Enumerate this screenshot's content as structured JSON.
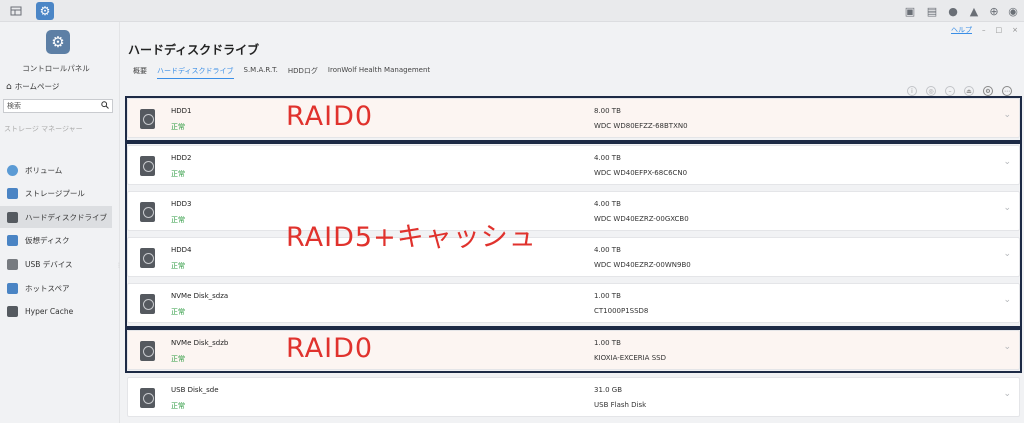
{
  "window": {
    "help_label": "ヘルプ",
    "controls": [
      "–",
      "□",
      "×"
    ]
  },
  "topbar": {
    "left_icons": [
      "window-icon",
      "control-panel-tab-icon"
    ],
    "right_icons": [
      "lock-icon",
      "monitor-icon",
      "chat-icon",
      "bell-icon",
      "globe-icon",
      "user-icon"
    ]
  },
  "sidebar": {
    "app_title": "コントロールパネル",
    "home_label": "ホームページ",
    "search_placeholder": "検索",
    "section_label": "ストレージ マネージャー",
    "items": [
      {
        "label": "ボリューム",
        "icon": "volume-icon",
        "color": "#5b9bd5"
      },
      {
        "label": "ストレージプール",
        "icon": "storage-pool-icon",
        "color": "#4a84c4"
      },
      {
        "label": "ハードディスクドライブ",
        "icon": "hdd-icon",
        "color": "#555a60"
      },
      {
        "label": "仮想ディスク",
        "icon": "virtual-disk-icon",
        "color": "#4a84c4"
      },
      {
        "label": "USB デバイス",
        "icon": "usb-icon",
        "color": "#777b80"
      },
      {
        "label": "ホットスペア",
        "icon": "hot-spare-icon",
        "color": "#4a84c4"
      },
      {
        "label": "Hyper Cache",
        "icon": "hyper-cache-icon",
        "color": "#555a60"
      }
    ],
    "active_index": 2
  },
  "main": {
    "title": "ハードディスクドライブ",
    "tabs": [
      "概要",
      "ハードディスクドライブ",
      "S.M.A.R.T.",
      "HDDログ",
      "IronWolf Health Management"
    ],
    "active_tab": 1
  },
  "disks": [
    {
      "name": "HDD1",
      "status": "正常",
      "capacity": "8.00 TB",
      "model": "WDC WD80EFZZ-68BTXN0"
    },
    {
      "name": "HDD2",
      "status": "正常",
      "capacity": "4.00 TB",
      "model": "WDC WD40EFPX-68C6CN0"
    },
    {
      "name": "HDD3",
      "status": "正常",
      "capacity": "4.00 TB",
      "model": "WDC WD40EZRZ-00GXCB0"
    },
    {
      "name": "HDD4",
      "status": "正常",
      "capacity": "4.00 TB",
      "model": "WDC WD40EZRZ-00WN9B0"
    },
    {
      "name": "NVMe Disk_sdza",
      "status": "正常",
      "capacity": "1.00 TB",
      "model": "CT1000P1SSD8"
    },
    {
      "name": "NVMe Disk_sdzb",
      "status": "正常",
      "capacity": "1.00 TB",
      "model": "KIOXIA-EXCERIA SSD"
    },
    {
      "name": "USB Disk_sde",
      "status": "正常",
      "capacity": "31.0 GB",
      "model": "USB Flash Disk"
    }
  ],
  "annotations": [
    {
      "label": "RAID0"
    },
    {
      "label": "RAID5+キャッシュ"
    },
    {
      "label": "RAID0"
    }
  ]
}
